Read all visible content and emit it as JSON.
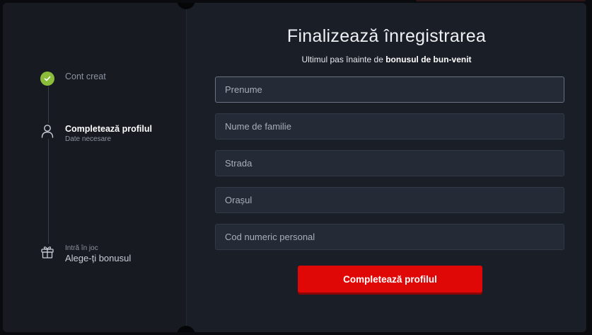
{
  "colors": {
    "accent_red": "#e00707",
    "check_green": "#8bbd3a",
    "panel_bg": "#1a1e26",
    "sidebar_bg": "#171a21",
    "field_bg": "#242a36"
  },
  "steps": [
    {
      "title": "Cont creat",
      "subtitle": "",
      "icon": "check-icon",
      "state": "done"
    },
    {
      "title": "Completează profilul",
      "subtitle": "Date necesare",
      "icon": "user-icon",
      "state": "active"
    },
    {
      "title": "Alege-ți bonusul",
      "subtitle": "Intră în joc",
      "icon": "gift-icon",
      "state": "pending"
    }
  ],
  "form": {
    "title": "Finalizează înregistrarea",
    "subtitle_prefix": "Ultimul pas înainte de ",
    "subtitle_bold": "bonusul de bun-venit",
    "fields": [
      {
        "placeholder": "Prenume",
        "value": ""
      },
      {
        "placeholder": "Nume de familie",
        "value": ""
      },
      {
        "placeholder": "Strada",
        "value": ""
      },
      {
        "placeholder": "Orașul",
        "value": ""
      },
      {
        "placeholder": "Cod numeric personal",
        "value": ""
      }
    ],
    "submit_label": "Completează profilul"
  }
}
